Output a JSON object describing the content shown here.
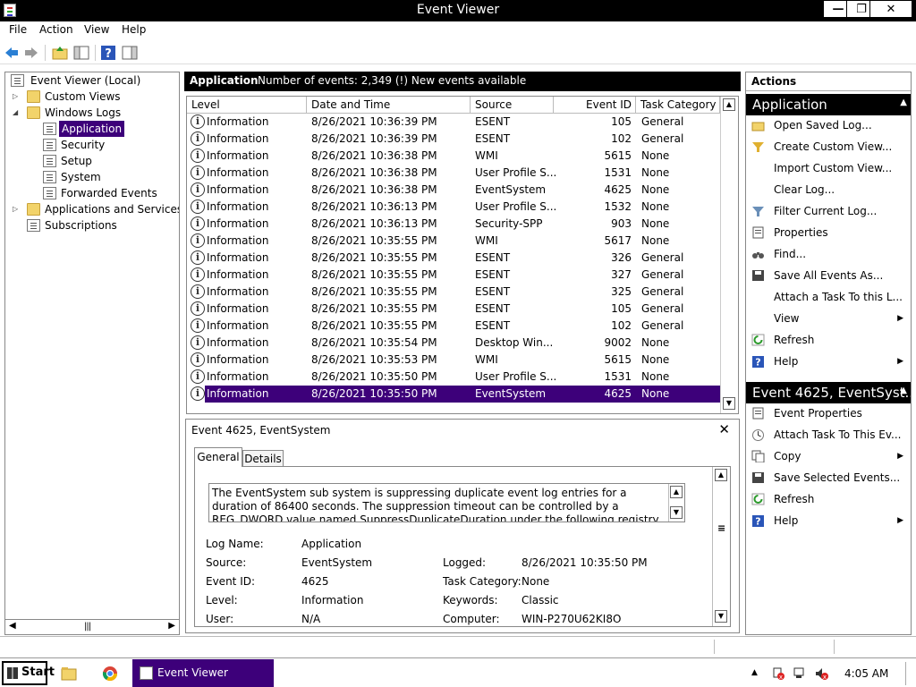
{
  "window": {
    "title": "Event Viewer",
    "min": "—",
    "max": "❐",
    "close": "✕"
  },
  "menu": [
    "File",
    "Action",
    "View",
    "Help"
  ],
  "tree": {
    "root": "Event Viewer (Local)",
    "custom_views": "Custom Views",
    "windows_logs": "Windows Logs",
    "logs": [
      "Application",
      "Security",
      "Setup",
      "System",
      "Forwarded Events"
    ],
    "apps_services": "Applications and Services Lo",
    "subscriptions": "Subscriptions"
  },
  "center": {
    "log_name": "Application",
    "summary": "Number of events: 2,349 (!) New events available"
  },
  "table": {
    "columns": [
      "Level",
      "Date and Time",
      "Source",
      "Event ID",
      "Task Category"
    ],
    "rows": [
      {
        "level": "Information",
        "date": "8/26/2021 10:36:39 PM",
        "source": "ESENT",
        "id": "105",
        "cat": "General"
      },
      {
        "level": "Information",
        "date": "8/26/2021 10:36:39 PM",
        "source": "ESENT",
        "id": "102",
        "cat": "General"
      },
      {
        "level": "Information",
        "date": "8/26/2021 10:36:38 PM",
        "source": "WMI",
        "id": "5615",
        "cat": "None"
      },
      {
        "level": "Information",
        "date": "8/26/2021 10:36:38 PM",
        "source": "User Profile S...",
        "id": "1531",
        "cat": "None"
      },
      {
        "level": "Information",
        "date": "8/26/2021 10:36:38 PM",
        "source": "EventSystem",
        "id": "4625",
        "cat": "None"
      },
      {
        "level": "Information",
        "date": "8/26/2021 10:36:13 PM",
        "source": "User Profile S...",
        "id": "1532",
        "cat": "None"
      },
      {
        "level": "Information",
        "date": "8/26/2021 10:36:13 PM",
        "source": "Security-SPP",
        "id": "903",
        "cat": "None"
      },
      {
        "level": "Information",
        "date": "8/26/2021 10:35:55 PM",
        "source": "WMI",
        "id": "5617",
        "cat": "None"
      },
      {
        "level": "Information",
        "date": "8/26/2021 10:35:55 PM",
        "source": "ESENT",
        "id": "326",
        "cat": "General"
      },
      {
        "level": "Information",
        "date": "8/26/2021 10:35:55 PM",
        "source": "ESENT",
        "id": "327",
        "cat": "General"
      },
      {
        "level": "Information",
        "date": "8/26/2021 10:35:55 PM",
        "source": "ESENT",
        "id": "325",
        "cat": "General"
      },
      {
        "level": "Information",
        "date": "8/26/2021 10:35:55 PM",
        "source": "ESENT",
        "id": "105",
        "cat": "General"
      },
      {
        "level": "Information",
        "date": "8/26/2021 10:35:55 PM",
        "source": "ESENT",
        "id": "102",
        "cat": "General"
      },
      {
        "level": "Information",
        "date": "8/26/2021 10:35:54 PM",
        "source": "Desktop Win...",
        "id": "9002",
        "cat": "None"
      },
      {
        "level": "Information",
        "date": "8/26/2021 10:35:53 PM",
        "source": "WMI",
        "id": "5615",
        "cat": "None"
      },
      {
        "level": "Information",
        "date": "8/26/2021 10:35:50 PM",
        "source": "User Profile S...",
        "id": "1531",
        "cat": "None"
      },
      {
        "level": "Information",
        "date": "8/26/2021 10:35:50 PM",
        "source": "EventSystem",
        "id": "4625",
        "cat": "None",
        "selected": true
      }
    ]
  },
  "detail": {
    "title": "Event 4625, EventSystem",
    "tabs": [
      "General",
      "Details"
    ],
    "description": "The EventSystem sub system is suppressing duplicate event log entries for a duration of 86400 seconds.  The suppression timeout can be controlled by a REG_DWORD value named SuppressDuplicateDuration under the following registry key: HKLM\\Software\\Microsoft",
    "fields": {
      "log_name_label": "Log Name:",
      "log_name": "Application",
      "source_label": "Source:",
      "source": "EventSystem",
      "logged_label": "Logged:",
      "logged": "8/26/2021 10:35:50 PM",
      "event_id_label": "Event ID:",
      "event_id": "4625",
      "task_cat_label": "Task Category:",
      "task_cat": "None",
      "level_label": "Level:",
      "level": "Information",
      "keywords_label": "Keywords:",
      "keywords": "Classic",
      "user_label": "User:",
      "user": "N/A",
      "computer_label": "Computer:",
      "computer": "WIN-P270U62KI8O"
    }
  },
  "actions": {
    "header": "Actions",
    "section1": "Application",
    "items1": [
      "Open Saved Log...",
      "Create Custom View...",
      "Import Custom View...",
      "Clear Log...",
      "Filter Current Log...",
      "Properties",
      "Find...",
      "Save All Events As...",
      "Attach a Task To this L...",
      "View",
      "Refresh",
      "Help"
    ],
    "section2": "Event 4625, EventSyst...",
    "items2": [
      "Event Properties",
      "Attach Task To This Ev...",
      "Copy",
      "Save Selected Events...",
      "Refresh",
      "Help"
    ]
  },
  "taskbar": {
    "start": "Start",
    "task": "Event Viewer",
    "clock": "4:05 AM"
  },
  "colors": {
    "selection": "#3d007a",
    "titlebar": "#000000"
  }
}
